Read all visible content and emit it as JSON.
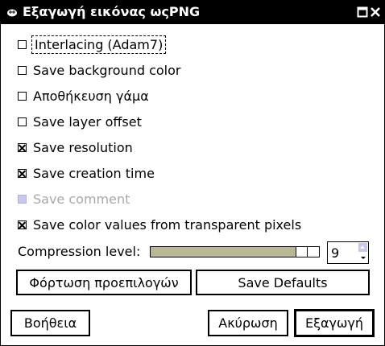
{
  "window": {
    "title": "Εξαγωγή εικόνας ωςPNG",
    "app_icon": "wilber-icon",
    "maximize_icon": "maximize-icon",
    "close_icon": "close-icon"
  },
  "options": [
    {
      "label": "Interlacing (Adam7)",
      "checked": false,
      "enabled": true,
      "focused": true
    },
    {
      "label": "Save background color",
      "checked": false,
      "enabled": true
    },
    {
      "label": "Αποθήκευση γάμα",
      "checked": false,
      "enabled": true
    },
    {
      "label": "Save layer offset",
      "checked": false,
      "enabled": true
    },
    {
      "label": "Save resolution",
      "checked": true,
      "enabled": true
    },
    {
      "label": "Save creation time",
      "checked": true,
      "enabled": true
    },
    {
      "label": "Save comment",
      "checked": false,
      "enabled": false
    },
    {
      "label": "Save color values from transparent pixels",
      "checked": true,
      "enabled": true
    }
  ],
  "compression": {
    "label": "Compression level:",
    "value": "9",
    "min": 0,
    "max": 9
  },
  "buttons": {
    "load_defaults": "Φόρτωση προεπιλογών",
    "save_defaults": "Save Defaults",
    "help": "Βοήθεια",
    "cancel": "Ακύρωση",
    "export": "Εξαγωγή"
  },
  "colors": {
    "titlebar": "#000000",
    "slider_fill": "#b8b894",
    "disabled_check": "#c8c8ee",
    "disabled_text": "#a8a8a8"
  }
}
